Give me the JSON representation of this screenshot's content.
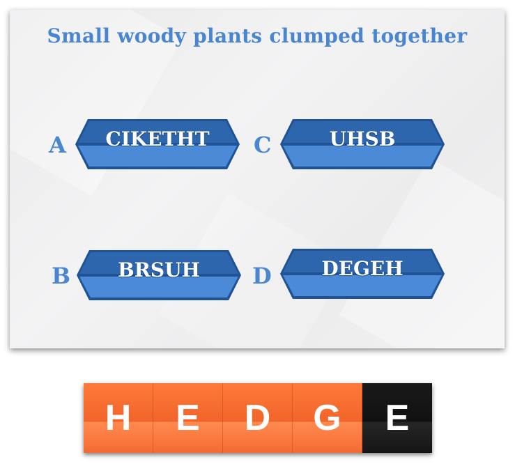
{
  "question": "Small woody plants clumped together",
  "options": [
    {
      "letter": "A",
      "text": "CIKETHT"
    },
    {
      "letter": "B",
      "text": "BRSUH"
    },
    {
      "letter": "C",
      "text": "UHSB"
    },
    {
      "letter": "D",
      "text": "DEGEH"
    }
  ],
  "answer": {
    "letters": [
      "H",
      "E",
      "D",
      "G",
      "E"
    ],
    "tile_colors": [
      "orange",
      "orange",
      "orange",
      "orange",
      "black"
    ]
  },
  "colors": {
    "accent_blue": "#4a86cf",
    "button_dark": "#2a5f9e",
    "button_light": "#4a8ad6",
    "tile_orange": "#f1642a",
    "tile_black": "#111111"
  }
}
